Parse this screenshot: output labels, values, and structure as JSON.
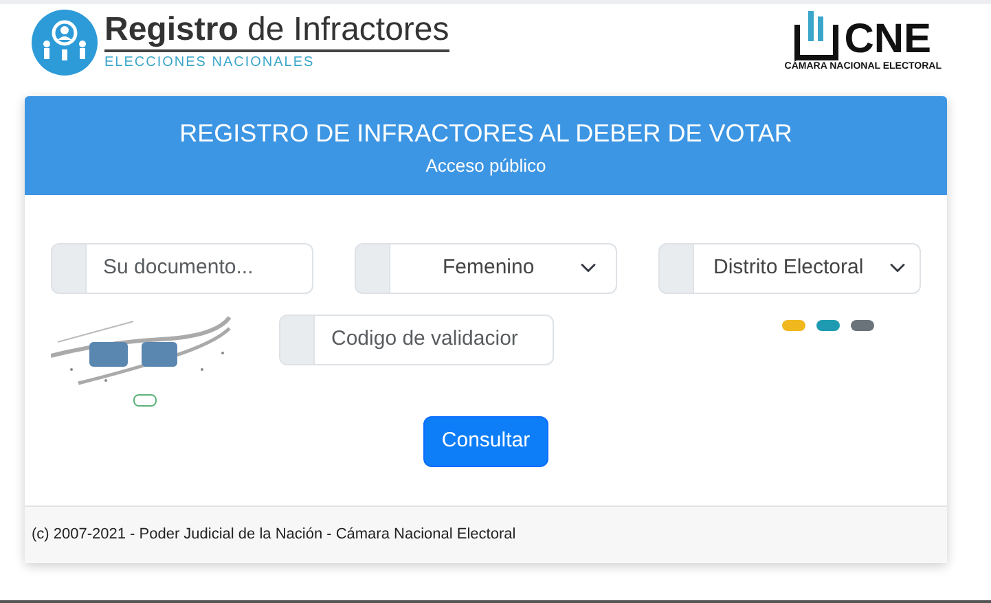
{
  "header": {
    "logo_title": "Registro",
    "logo_title_rest": "de Infractores",
    "logo_subtitle": "ELECCIONES NACIONALES",
    "brand": "CNE",
    "brand_subtitle": "CÁMARA NACIONAL ELECTORAL"
  },
  "card": {
    "title": "REGISTRO DE INFRACTORES AL DEBER DE VOTAR",
    "subtitle": "Acceso público"
  },
  "fields": [
    {
      "kind": "input",
      "placeholder": "Su documento..."
    },
    {
      "kind": "select",
      "value": "Femenino"
    },
    {
      "kind": "select",
      "value": "Distrito Electoral"
    }
  ],
  "captcha": {
    "kind": "picture",
    "code_placeholder": "Codigo de validacior"
  },
  "loader_dots": [
    {
      "color": "#f0b81c"
    },
    {
      "color": "#1e9bb0"
    },
    {
      "color": "#6b737a"
    }
  ],
  "submit": "Consultar",
  "footer": "(c) 2007-2021 - Poder Judicial de la Nación - Cámara Nacional Electoral"
}
